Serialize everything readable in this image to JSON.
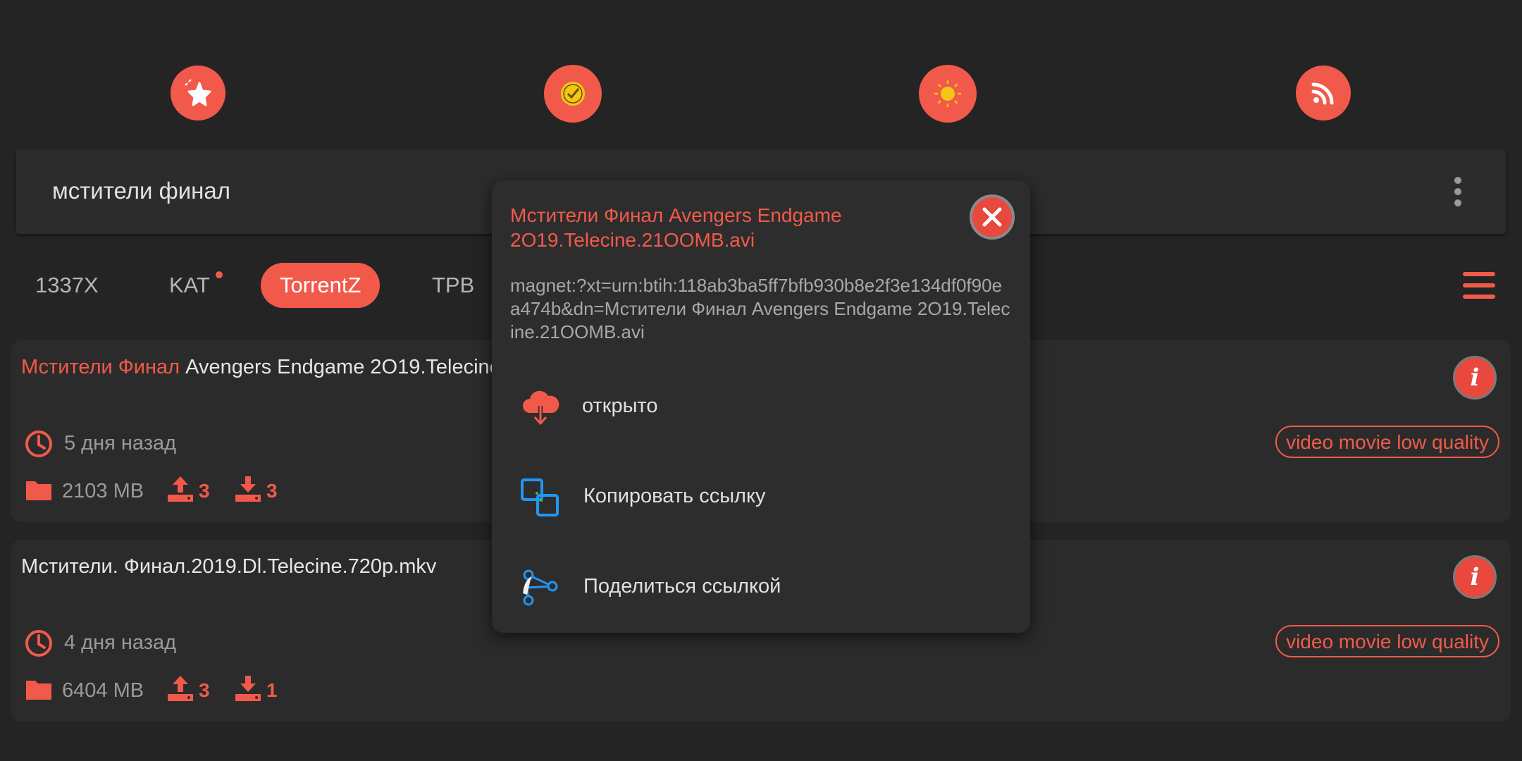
{
  "top_icons": [
    "favorites-star-icon",
    "history-clock-icon",
    "theme-sun-icon",
    "rss-feed-icon"
  ],
  "search": {
    "query": "мстители финал"
  },
  "tabs": [
    {
      "label": "1337X",
      "active": false
    },
    {
      "label": "KAT",
      "active": false,
      "badge": true
    },
    {
      "label": "TorrentZ",
      "active": true
    },
    {
      "label": "TPB",
      "active": false
    }
  ],
  "results": [
    {
      "title_highlight": "Мстители Финал",
      "title_rest": " Avengers Endgame 2O19.Telecine.21OOMB.avi",
      "time": "5 дня назад",
      "tag": "video movie low quality",
      "size": "2103 MB",
      "uploads": "3",
      "downloads": "3"
    },
    {
      "title_highlight": "",
      "title_rest": "Мстители. Финал.2019.Dl.Telecine.720p.mkv",
      "time": "4 дня назад",
      "tag": "video movie low quality",
      "size": "6404 MB",
      "uploads": "3",
      "downloads": "1"
    }
  ],
  "dialog": {
    "title": "Мстители Финал Avengers Endgame 2O19.Telecine.21OOMB.avi",
    "magnet": "magnet:?xt=urn:btih:118ab3ba5ff7bfb930b8e2f3e134df0f90ea474b&dn=Мстители Финал Avengers Endgame 2O19.Telecine.21OOMB.avi",
    "actions": [
      "открыто",
      "Копировать ссылку",
      "Поделиться ссылкой"
    ]
  },
  "colors": {
    "accent": "#f15a4a",
    "background": "#242424",
    "card": "#2b2b2b",
    "dialog": "#2d2d2d"
  }
}
